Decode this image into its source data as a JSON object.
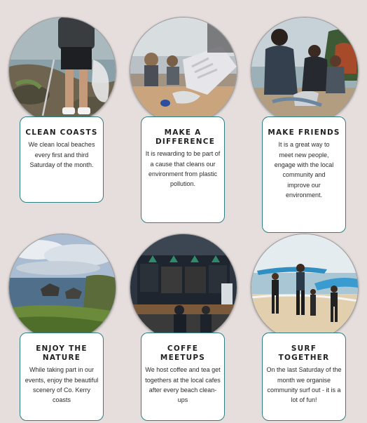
{
  "cards": [
    {
      "title": "CLEAN COASTS",
      "text": "We clean local beaches every first and third Saturday of the month.",
      "photo_icon": "beach-cleanup-photo"
    },
    {
      "title": "MAKE A DIFFERENCE",
      "text": "It is rewarding to be part of a cause that cleans our environment from plastic pollution.",
      "photo_icon": "gloved-hand-plastic-photo"
    },
    {
      "title": "MAKE FRIENDS",
      "text": "It is a great way to meet new people, engage with the local community and improve our environment.",
      "photo_icon": "volunteers-group-photo"
    },
    {
      "title": "ENJOY THE NATURE",
      "text": "While taking part in our events, enjoy the beautiful scenery of Co. Kerry coasts",
      "photo_icon": "coastline-photo"
    },
    {
      "title": "COFFE MEETUPS",
      "text": "We host coffee and tea get togethers at the local cafes after every beach clean-ups",
      "photo_icon": "cafe-photo"
    },
    {
      "title": "SURF TOGETHER",
      "text": "On the last Saturday of the month we organise community surf out - it is a lot of fun!",
      "photo_icon": "surfers-photo"
    }
  ],
  "colors": {
    "accent": "#2f7f82",
    "background": "#e6dedc"
  }
}
